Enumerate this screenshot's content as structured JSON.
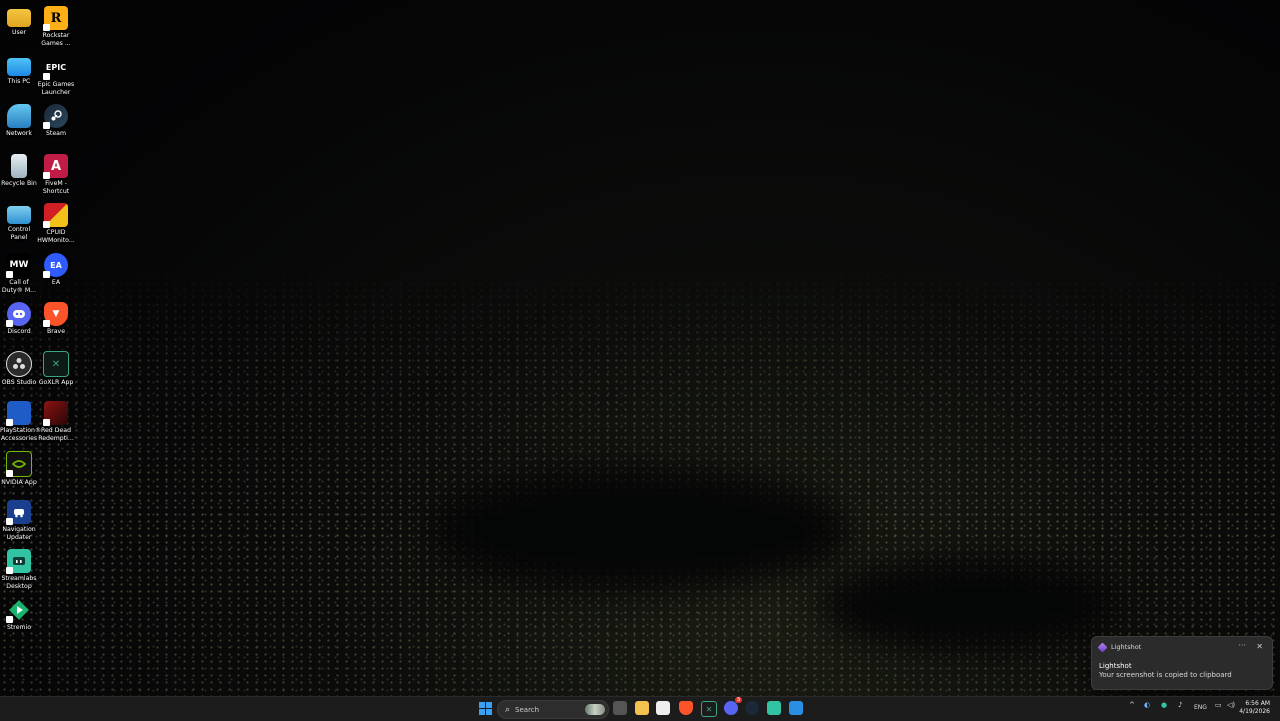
{
  "desktop": {
    "icons_col1": [
      {
        "name": "folder-icon",
        "label": "User"
      },
      {
        "name": "monitor-icon",
        "label": "This PC"
      },
      {
        "name": "network-icon",
        "label": "Network"
      },
      {
        "name": "recycle-bin-icon",
        "label": "Recycle Bin"
      },
      {
        "name": "control-panel-icon",
        "label": "Control\nPanel"
      },
      {
        "name": "call-of-duty-icon",
        "label": "Call of\nDuty® M..."
      },
      {
        "name": "discord-icon",
        "label": "Discord"
      },
      {
        "name": "obs-studio-icon",
        "label": "OBS Studio"
      },
      {
        "name": "playstation-icon",
        "label": "PlayStation®\nAccessories"
      },
      {
        "name": "nvidia-icon",
        "label": "NVIDIA App"
      },
      {
        "name": "navigation-updater-icon",
        "label": "Navigation\nUpdater"
      },
      {
        "name": "streamlabs-icon",
        "label": "Streamlabs\nDesktop"
      },
      {
        "name": "stremio-icon",
        "label": "Stremio"
      }
    ],
    "icons_col2": [
      {
        "name": "rockstar-icon",
        "label": "Rockstar\nGames ..."
      },
      {
        "name": "epic-games-icon",
        "label": "Epic Games\nLauncher"
      },
      {
        "name": "steam-icon",
        "label": "Steam"
      },
      {
        "name": "fivem-icon",
        "label": "FiveM -\nShortcut"
      },
      {
        "name": "cpuid-icon",
        "label": "CPUID\nHWMonito..."
      },
      {
        "name": "ea-icon",
        "label": "EA"
      },
      {
        "name": "brave-icon",
        "label": "Brave"
      },
      {
        "name": "goxlr-icon",
        "label": "GoXLR App"
      },
      {
        "name": "red-dead-icon",
        "label": "Red Dead\nRedempti..."
      }
    ],
    "icon_glyphs": {
      "rockstar": "R",
      "epic": "EPIC",
      "cod": "MW",
      "ea": "EA",
      "brave": "▼",
      "goxlr": "✕",
      "fivem": "A"
    }
  },
  "taskbar": {
    "search_placeholder": "Search",
    "tray_lang": "ENG",
    "time": "6:56 AM",
    "date": "4/19/2026",
    "chat_badge": "3"
  },
  "toast": {
    "app_name": "Lightshot",
    "title": "Lightshot",
    "message": "Your screenshot is copied to clipboard",
    "more_glyph": "···",
    "close_glyph": "✕"
  },
  "colors": {
    "taskbar_bg": "#1c1c1c",
    "toast_bg": "#2b2b2b",
    "windows_blue": "#3aa0f3"
  }
}
